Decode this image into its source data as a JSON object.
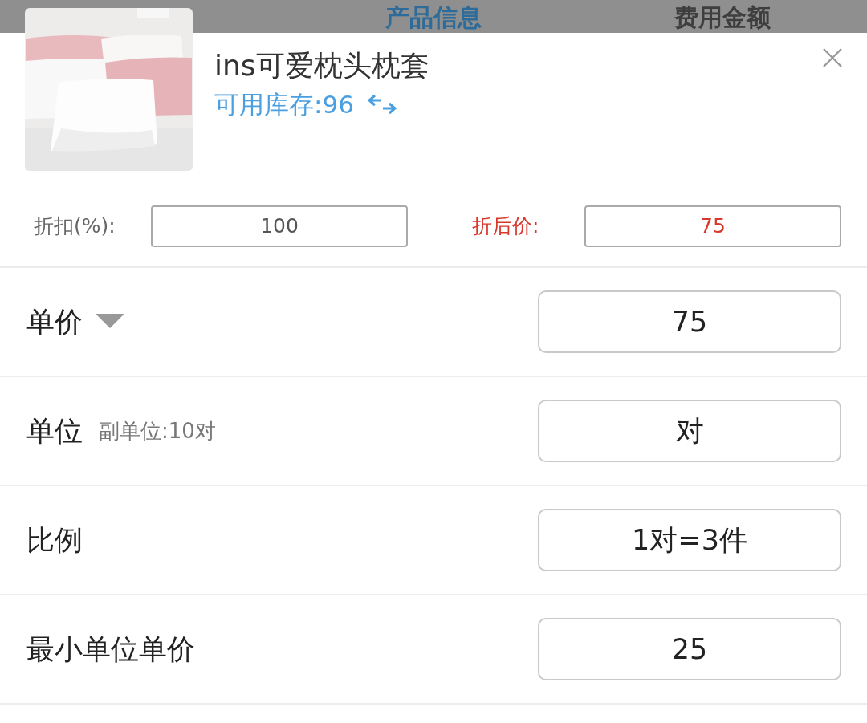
{
  "tabs": [
    {
      "label": "产品信息",
      "selected": true
    },
    {
      "label": "费用金额",
      "selected": false
    }
  ],
  "product": {
    "name": "ins可爱枕头枕套",
    "stock": "可用库存:96"
  },
  "discount": {
    "label": "折扣(%):",
    "value": "100",
    "price_label": "折后价:",
    "price_value": "75"
  },
  "rows": [
    {
      "kind": "dropdown",
      "label": "单价",
      "value": "75"
    },
    {
      "kind": "sub",
      "label": "单位",
      "note": "副单位:10对",
      "value": "对"
    },
    {
      "kind": "plain",
      "label": "比例",
      "value": "1对=3件"
    },
    {
      "kind": "plain",
      "label": "最小单位单价",
      "value": "25"
    }
  ]
}
